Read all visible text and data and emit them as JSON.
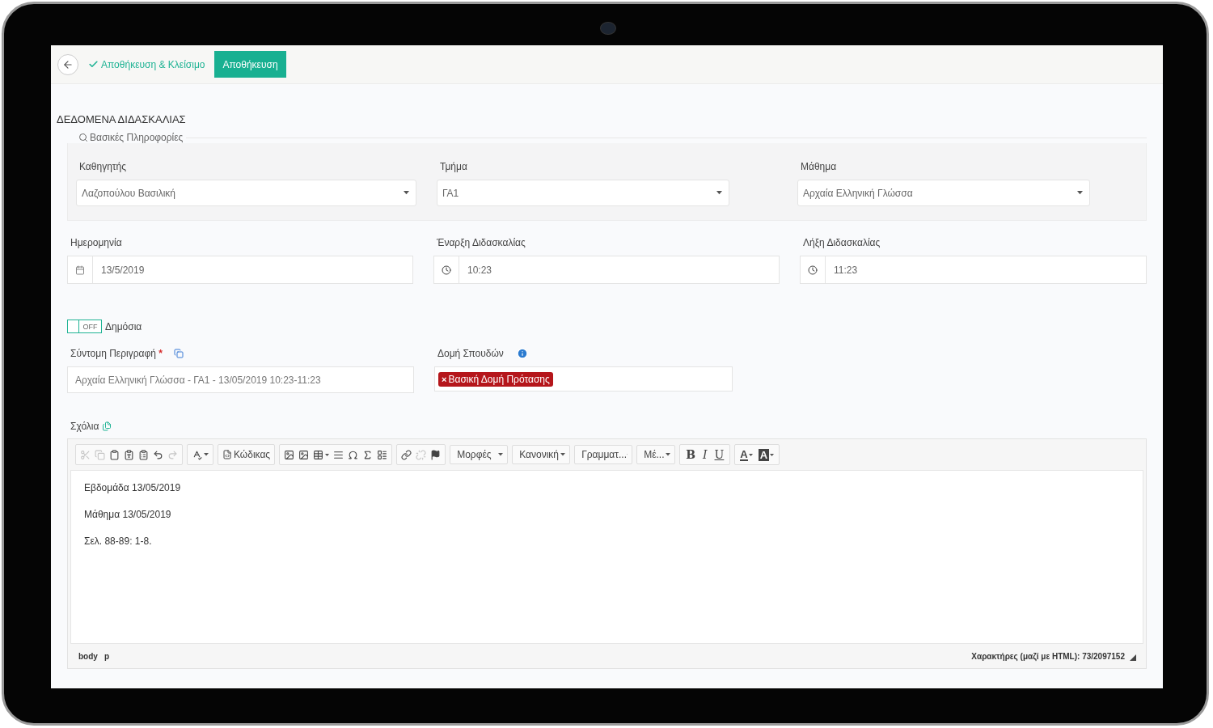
{
  "topbar": {
    "save_close": "Αποθήκευση & Κλείσιμο",
    "save": "Αποθήκευση"
  },
  "title": "ΔΕΔΟΜΕΝΑ ΔΙΔΑΣΚΑΛΙΑΣ",
  "basic_info": {
    "legend": "Βασικές Πληροφορίες",
    "selects": [
      {
        "label": "Καθηγητής",
        "value": "Λαζοπούλου Βασιλική"
      },
      {
        "label": "Τμήμα",
        "value": "ΓΑ1"
      },
      {
        "label": "Μάθημα",
        "value": "Αρχαία Ελληνική Γλώσσα"
      }
    ]
  },
  "time_fields": [
    {
      "kind": "date",
      "label": "Ημερομηνία",
      "value": "13/5/2019"
    },
    {
      "kind": "time",
      "label": "Έναρξη Διδασκαλίας",
      "value": "10:23"
    },
    {
      "kind": "time",
      "label": "Λήξη Διδασκαλίας",
      "value": "11:23"
    }
  ],
  "public_toggle": {
    "label": "Δημόσια",
    "on": false,
    "state_text": "OFF"
  },
  "short_description": {
    "label": "Σύντομη Περιγραφή",
    "required_mark": "*",
    "value": "Αρχαία Ελληνική Γλώσσα  - ΓΑ1 - 13/05/2019 10:23-11:23"
  },
  "study_structure": {
    "label": "Δομή Σπουδών",
    "tags": [
      {
        "remove": "×",
        "label": "Βασική Δομή Πρότασης"
      }
    ]
  },
  "comments": {
    "label": "Σχόλια",
    "toolbar": {
      "source": "Κώδικας",
      "dropdowns": [
        "Μορφές",
        "Κανονική",
        "Γραμματ...",
        "Μέ..."
      ],
      "bold": "B",
      "italic": "I",
      "underline": "U",
      "text_color": "A",
      "bg_color": "A"
    },
    "paragraphs": [
      "Εβδομάδα 13/05/2019",
      "Μάθημα 13/05/2019",
      "Σελ. 88-89: 1-8."
    ],
    "path": [
      "body",
      "p"
    ],
    "counter": "Χαρακτήρες (μαζί με HTML): 73/2097152"
  }
}
